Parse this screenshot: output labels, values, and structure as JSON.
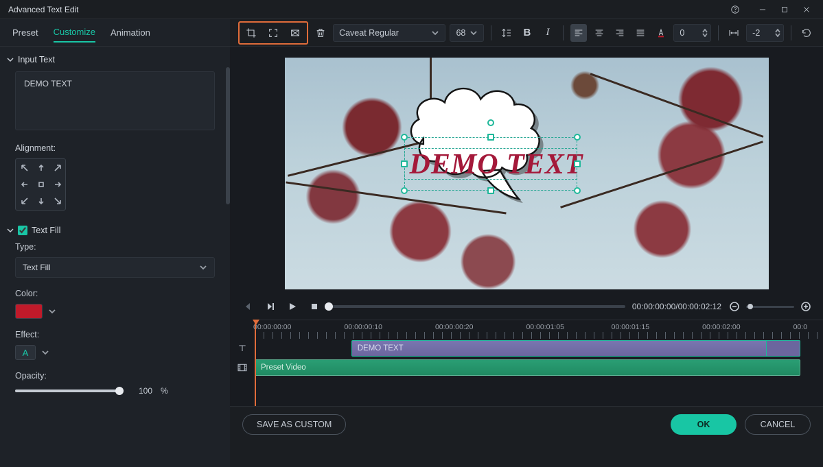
{
  "window": {
    "title": "Advanced Text Edit"
  },
  "tabs": {
    "preset": "Preset",
    "customize": "Customize",
    "animation": "Animation"
  },
  "inputText": {
    "section_label": "Input Text",
    "value": "DEMO TEXT",
    "alignment_label": "Alignment:"
  },
  "textFill": {
    "section_label": "Text Fill",
    "type_label": "Type:",
    "type_value": "Text Fill",
    "color_label": "Color:",
    "color_value": "#c01a2a",
    "effect_label": "Effect:",
    "effect_char": "A",
    "opacity_label": "Opacity:",
    "opacity_value": "100",
    "opacity_unit": "%"
  },
  "toolbar": {
    "font": "Caveat Regular",
    "size": "68",
    "fontColor": "0",
    "tracking": "-2"
  },
  "preview": {
    "demo_text": "DEMO TEXT"
  },
  "playback": {
    "timecode": "00:00:00:00/00:00:02:12"
  },
  "timeline": {
    "labels": [
      "00:00:00:00",
      "00:00:00:10",
      "00:00:00:20",
      "00:00:01:05",
      "00:00:01:15",
      "00:00:02:00",
      "00:0"
    ],
    "text_clip_label": "DEMO TEXT",
    "video_clip_label": "Preset Video"
  },
  "footer": {
    "save_custom": "SAVE AS CUSTOM",
    "ok": "OK",
    "cancel": "CANCEL"
  }
}
